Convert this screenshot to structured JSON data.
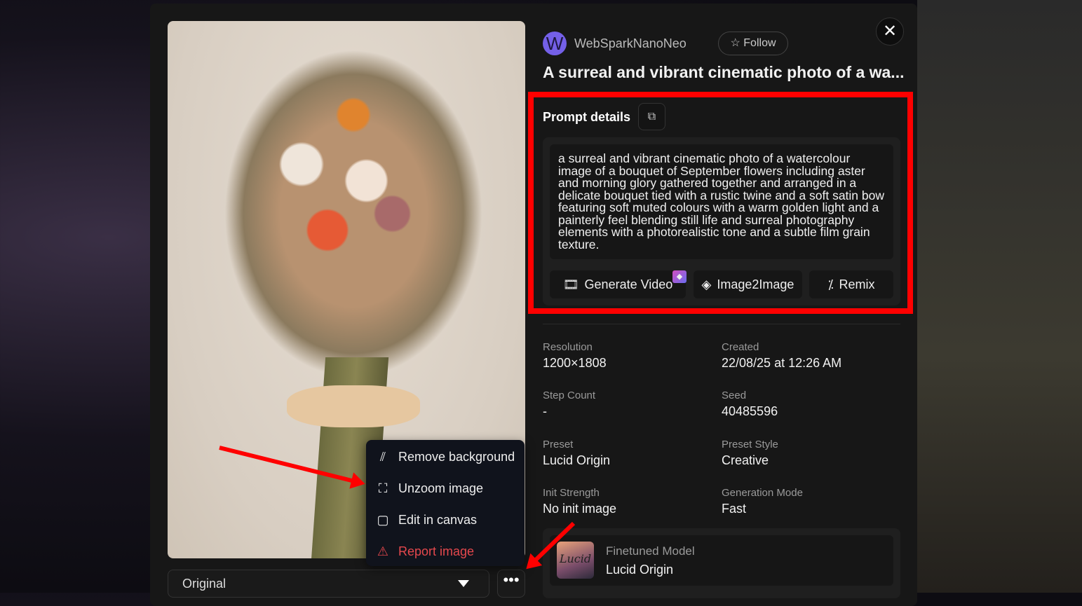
{
  "header": {
    "avatar_letter": "W",
    "username": "WebSparkNanoNeo",
    "follow_label": "Follow",
    "close_label": "✕",
    "title": "A surreal and vibrant cinematic photo of a wa..."
  },
  "prompt": {
    "label": "Prompt details",
    "text": "a surreal and vibrant cinematic photo of a watercolour image of a bouquet of September flowers including aster and morning glory gathered together and arranged in a delicate bouquet tied with a rustic twine and a soft satin bow featuring soft muted colours with a warm golden light and a painterly feel blending still life and surreal photography elements with a photorealistic tone and a subtle film grain texture.",
    "actions": [
      {
        "label": "Generate Video",
        "icon": "film-icon"
      },
      {
        "label": "Image2Image",
        "icon": "layers-icon"
      },
      {
        "label": "Remix",
        "icon": "magic-wand-icon"
      }
    ]
  },
  "details": [
    {
      "label": "Resolution",
      "value": "1200×1808"
    },
    {
      "label": "Created",
      "value": "22/08/25 at 12:26 AM"
    },
    {
      "label": "Step Count",
      "value": "-"
    },
    {
      "label": "Seed",
      "value": "40485596"
    },
    {
      "label": "Preset",
      "value": "Lucid Origin"
    },
    {
      "label": "Preset Style",
      "value": "Creative"
    },
    {
      "label": "Init Strength",
      "value": "No init image"
    },
    {
      "label": "Generation Mode",
      "value": "Fast"
    }
  ],
  "model": {
    "label": "Finetuned Model",
    "value": "Lucid Origin",
    "thumb_text": "Lucid"
  },
  "image_controls": {
    "select_value": "Original",
    "more_label": "•••"
  },
  "menu": [
    {
      "label": "Remove background",
      "icon": "remove-background-icon"
    },
    {
      "label": "Unzoom image",
      "icon": "unzoom-icon"
    },
    {
      "label": "Edit in canvas",
      "icon": "canvas-icon"
    },
    {
      "label": "Report image",
      "icon": "warning-icon"
    }
  ],
  "colors": {
    "accent_red": "#ff0000",
    "report": "#e5484d",
    "avatar": "#7460e8"
  }
}
